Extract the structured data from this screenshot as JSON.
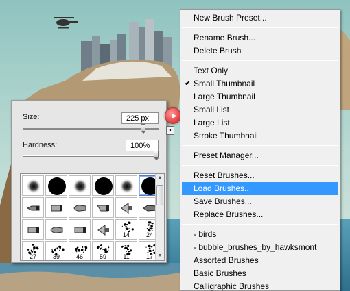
{
  "colors": {
    "menu_highlight": "#3399ff",
    "flyout_button": "#e8484a",
    "panel_bg": "#e6e6e6"
  },
  "brush_panel": {
    "size_label": "Size:",
    "size_value": "225 px",
    "size_slider_fraction": 0.9,
    "hardness_label": "Hardness:",
    "hardness_value": "100%",
    "hardness_slider_fraction": 1.0,
    "flyout_icon": "right-arrow-icon",
    "new_preset_icon": "new-preset-icon",
    "presets": [
      {
        "kind": "soft-round",
        "label": ""
      },
      {
        "kind": "hard-round",
        "label": ""
      },
      {
        "kind": "soft-round",
        "label": ""
      },
      {
        "kind": "hard-round",
        "label": ""
      },
      {
        "kind": "soft-round",
        "label": ""
      },
      {
        "kind": "hard-round",
        "label": "",
        "selected": true
      },
      {
        "kind": "pencil-brush",
        "label": ""
      },
      {
        "kind": "flat-brush",
        "label": ""
      },
      {
        "kind": "round-tip-brush",
        "label": ""
      },
      {
        "kind": "angle-brush",
        "label": ""
      },
      {
        "kind": "fan-brush",
        "label": ""
      },
      {
        "kind": "marker-brush",
        "label": ""
      },
      {
        "kind": "flat-brush",
        "label": ""
      },
      {
        "kind": "round-tip-brush",
        "label": ""
      },
      {
        "kind": "flat-brush",
        "label": ""
      },
      {
        "kind": "fan-brush",
        "label": ""
      },
      {
        "kind": "spatter",
        "label": "14"
      },
      {
        "kind": "spatter",
        "label": "24"
      },
      {
        "kind": "spatter",
        "label": "27"
      },
      {
        "kind": "spatter",
        "label": "39"
      },
      {
        "kind": "spatter",
        "label": "46"
      },
      {
        "kind": "spatter",
        "label": "59"
      },
      {
        "kind": "spatter",
        "label": "11"
      },
      {
        "kind": "spatter",
        "label": "17"
      }
    ]
  },
  "menu": {
    "items": [
      {
        "label": "New Brush Preset..."
      },
      {
        "label": "Rename Brush..."
      },
      {
        "label": "Delete Brush"
      },
      {
        "label": "Text Only"
      },
      {
        "label": "Small Thumbnail",
        "checked": true
      },
      {
        "label": "Large Thumbnail"
      },
      {
        "label": "Small List"
      },
      {
        "label": "Large List"
      },
      {
        "label": "Stroke Thumbnail"
      },
      {
        "label": "Preset Manager..."
      },
      {
        "label": "Reset Brushes..."
      },
      {
        "label": "Load Brushes...",
        "highlighted": true
      },
      {
        "label": "Save Brushes..."
      },
      {
        "label": "Replace Brushes..."
      },
      {
        "label": "- birds"
      },
      {
        "label": "- bubble_brushes_by_hawksmont"
      },
      {
        "label": "Assorted Brushes"
      },
      {
        "label": "Basic Brushes"
      },
      {
        "label": "Calligraphic Brushes"
      }
    ],
    "check_mark": "✔"
  }
}
